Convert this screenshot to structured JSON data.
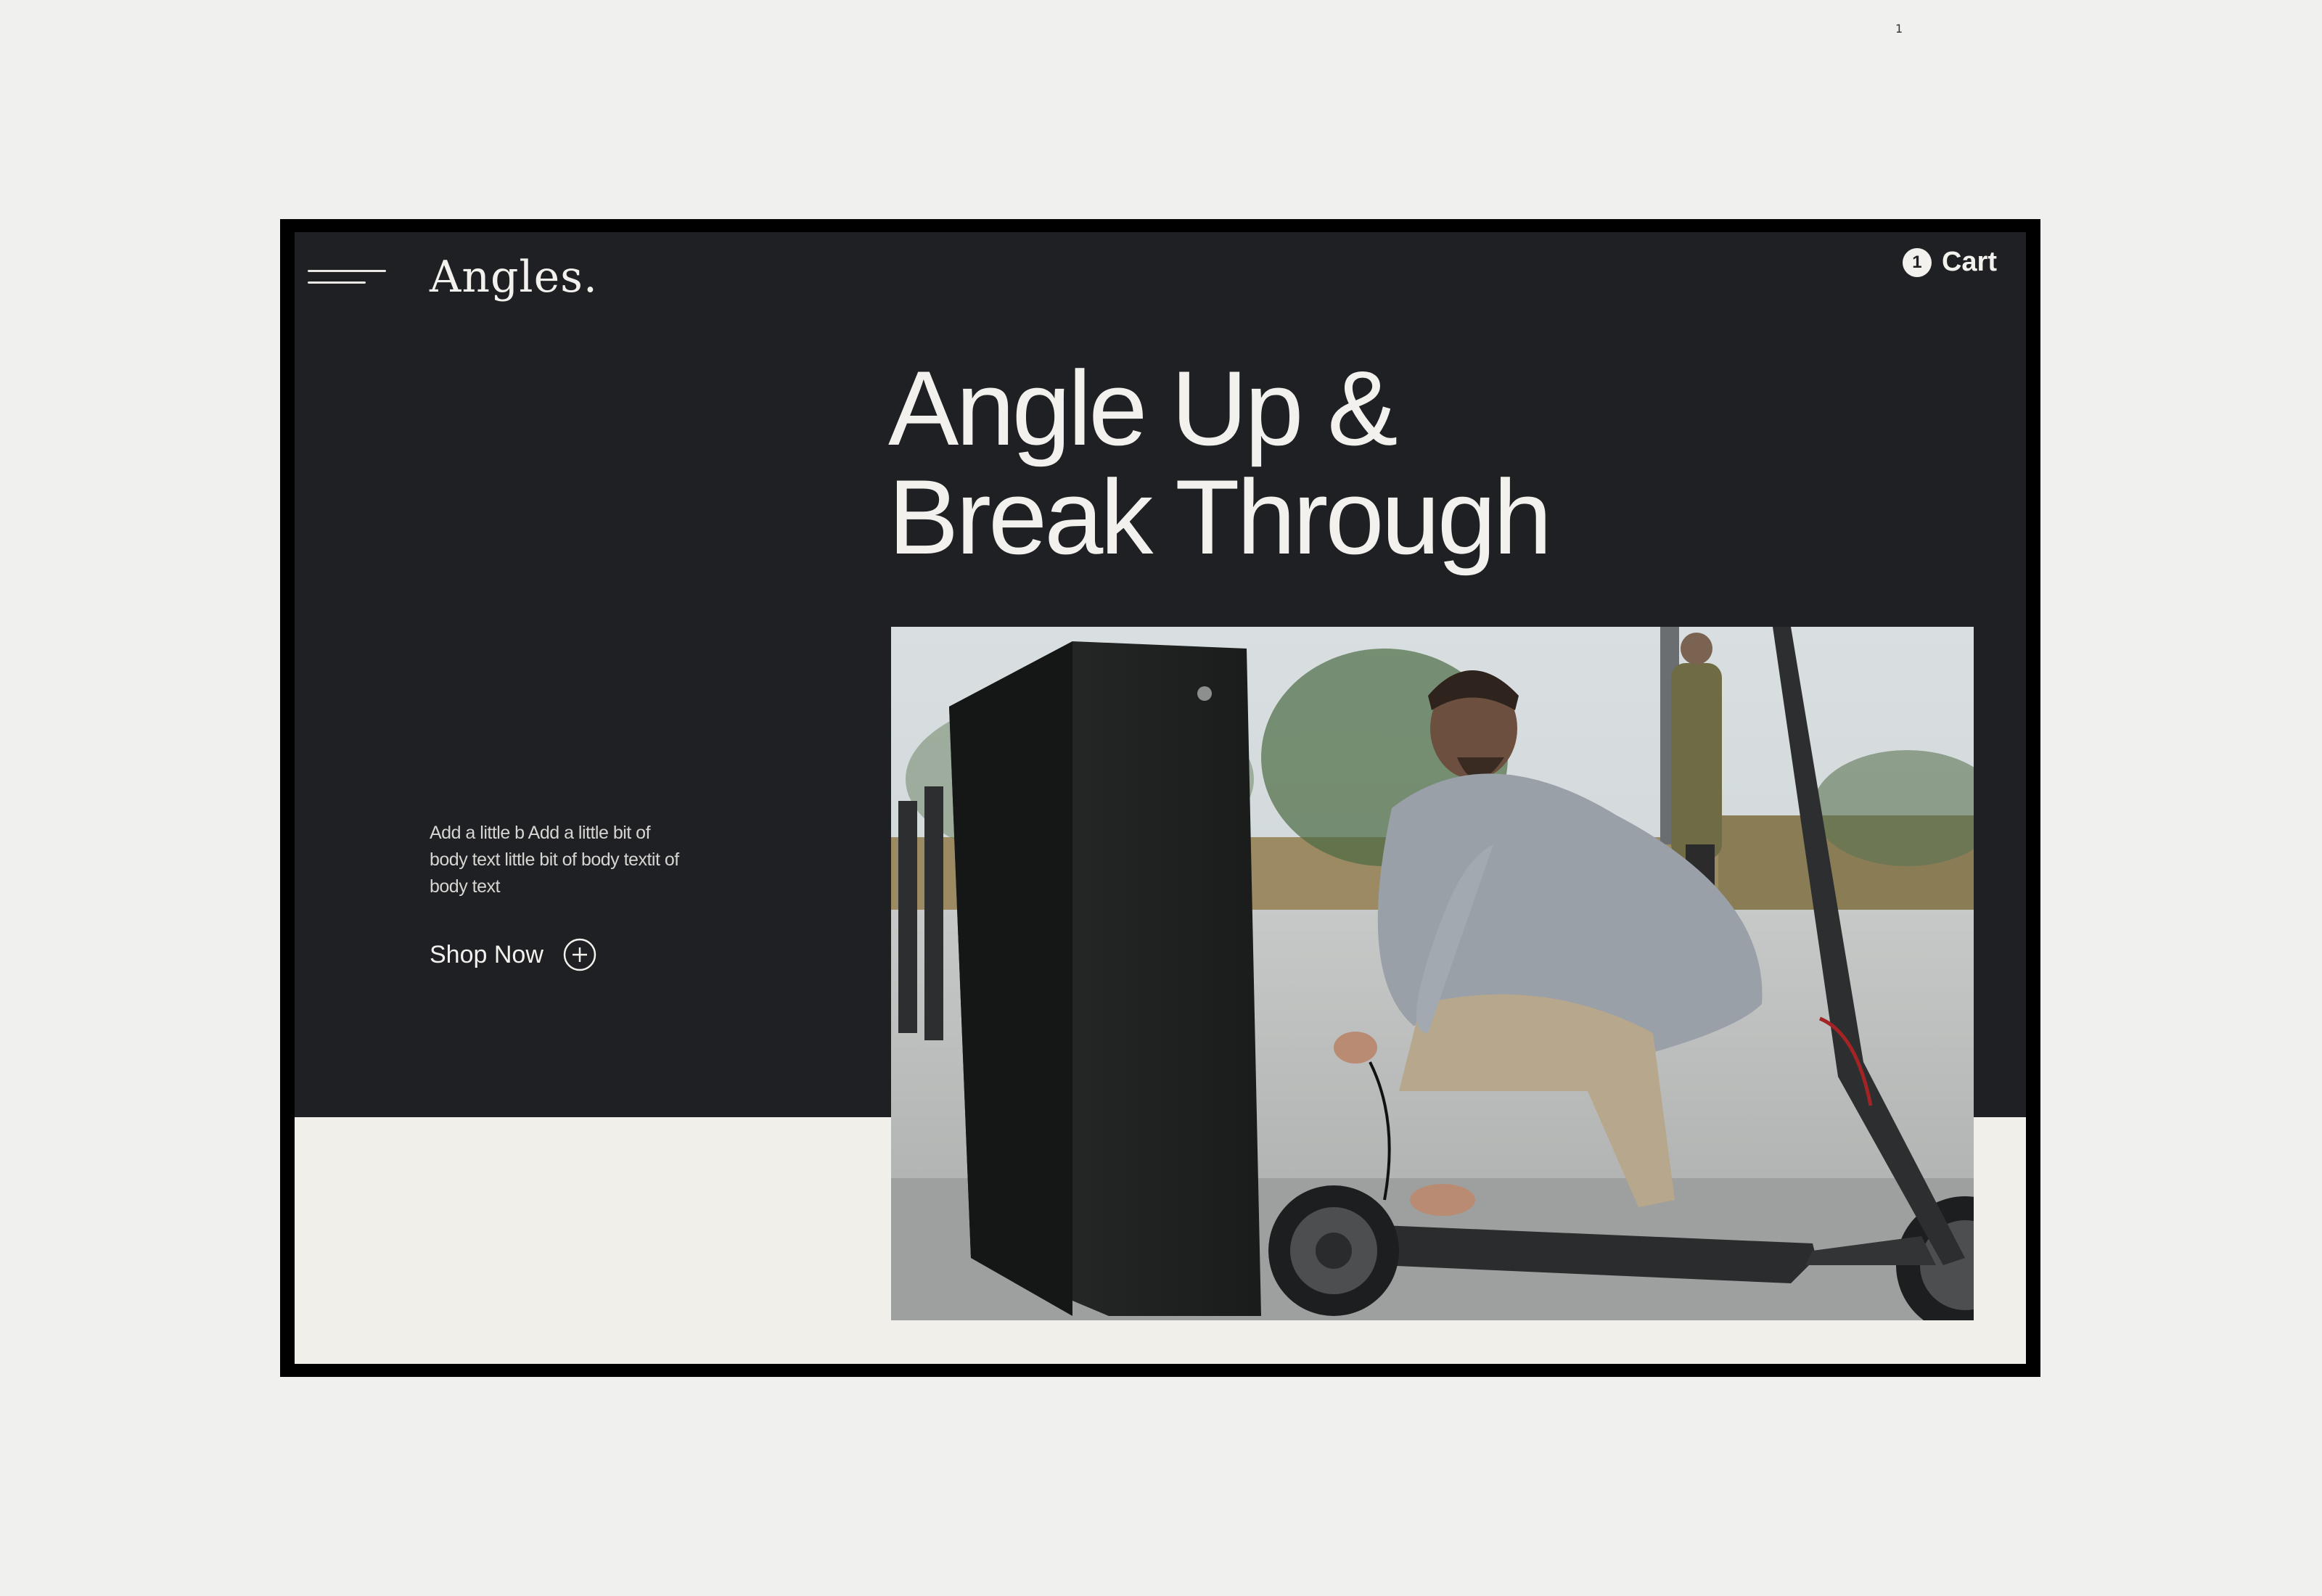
{
  "page_marker": "1",
  "header": {
    "logo": "Angles.",
    "cart_count": "1",
    "cart_label": "Cart"
  },
  "hero": {
    "headline_line1": "Angle Up &",
    "headline_line2": "Break Through",
    "body": "Add a little b Add a little bit of body text little bit of body textit of body text",
    "cta_label": "Shop Now"
  },
  "icons": {
    "menu": "hamburger-menu-icon",
    "cta": "plus-circle-icon"
  },
  "colors": {
    "dark_background": "#1f2023",
    "light_background": "#f0efea",
    "text_light": "#f2f1ed",
    "frame": "#000000",
    "page_background": "#f0f0ef"
  }
}
